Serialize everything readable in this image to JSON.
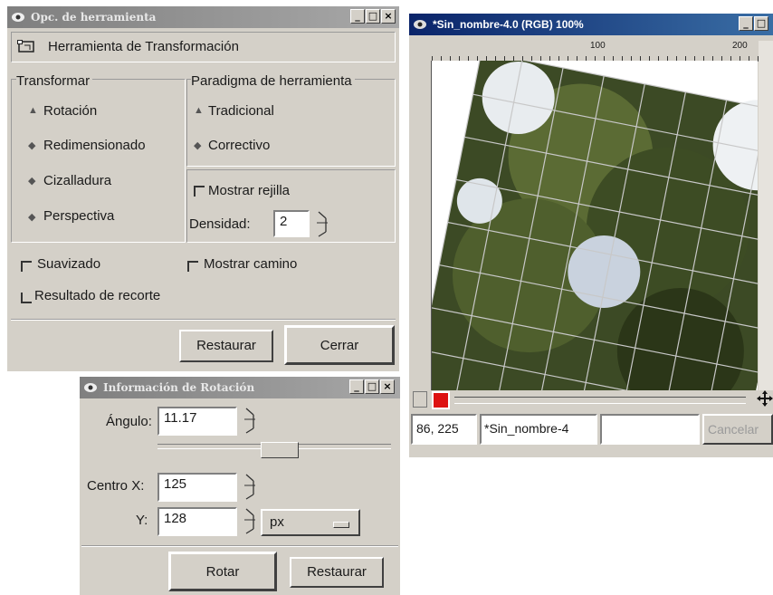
{
  "tool_options": {
    "title": "Opc. de herramienta",
    "tool_name": "Herramienta de Transformación",
    "transform_label": "Transformar",
    "transform_options": [
      "Rotación",
      "Redimensionado",
      "Cizalladura",
      "Perspectiva"
    ],
    "paradigm_label": "Paradigma de herramienta",
    "paradigm_options": [
      "Tradicional",
      "Correctivo"
    ],
    "show_grid_label": "Mostrar rejilla",
    "density_label": "Densidad:",
    "density_value": "2",
    "smooth_label": "Suavizado",
    "show_path_label": "Mostrar camino",
    "clip_label": "Resultado de recorte",
    "restore_button": "Restaurar",
    "close_button": "Cerrar"
  },
  "image_window": {
    "title": "*Sin_nombre-4.0 (RGB) 100%",
    "ruler_labels": [
      "100",
      "200"
    ],
    "status_coords": "86, 225",
    "status_name": "*Sin_nombre-4",
    "cancel_button": "Cancelar"
  },
  "rotation_info": {
    "title": "Información de Rotación",
    "angle_label": "Ángulo:",
    "angle_value": "11.17",
    "angle_slider_fraction": 0.53,
    "center_x_label": "Centro X:",
    "center_x_value": "125",
    "y_label": "Y:",
    "y_value": "128",
    "unit_value": "px",
    "rotate_button": "Rotar",
    "restore_button": "Restaurar"
  },
  "icons": [
    "gimp-eye-icon",
    "transform-tool-icon",
    "minimize-icon",
    "maximize-icon",
    "close-icon",
    "navigate-cross-icon",
    "quickmask-icon"
  ]
}
